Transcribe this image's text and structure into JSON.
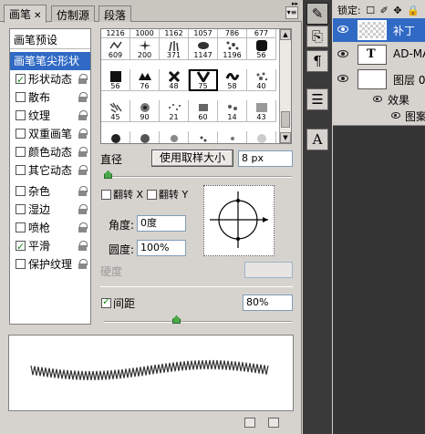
{
  "brush_panel": {
    "tabs": [
      "画笔",
      "仿制源",
      "段落"
    ],
    "list": {
      "header": "画笔预设",
      "selected": "画笔笔尖形状",
      "options": [
        {
          "label": "形状动态",
          "checked": true
        },
        {
          "label": "散布",
          "checked": false
        },
        {
          "label": "纹理",
          "checked": false
        },
        {
          "label": "双重画笔",
          "checked": false
        },
        {
          "label": "颜色动态",
          "checked": false
        },
        {
          "label": "其它动态",
          "checked": false
        },
        {
          "label": "杂色",
          "checked": false
        },
        {
          "label": "湿边",
          "checked": false
        },
        {
          "label": "喷枪",
          "checked": false
        },
        {
          "label": "平滑",
          "checked": true
        },
        {
          "label": "保护纹理",
          "checked": false
        }
      ]
    },
    "presets_top_numbers": [
      "1216",
      "1000",
      "1162",
      "1057",
      "786",
      "677"
    ],
    "preset_rows": [
      [
        "609",
        "200",
        "371",
        "1147",
        "1196",
        "56"
      ],
      [
        "56",
        "76",
        "48",
        "75",
        "58",
        "40"
      ],
      [
        "45",
        "90",
        "21",
        "60",
        "14",
        "43"
      ],
      [
        "",
        "",
        "",
        "",
        "",
        ""
      ]
    ],
    "selected_preset": "75",
    "diameter_label": "直径",
    "use_sample_size_button": "使用取样大小",
    "diameter_value": "8 px",
    "flip_x_label": "翻转 X",
    "flip_y_label": "翻转 Y",
    "angle_label": "角度:",
    "angle_value": "0度",
    "roundness_label": "圆度:",
    "roundness_value": "100%",
    "hardness_label": "硬度",
    "spacing_label": "间距",
    "spacing_checked": true,
    "spacing_value": "80%"
  },
  "layers_panel": {
    "lock_label": "锁定:",
    "layers": [
      {
        "name": "补丁",
        "type": "pixel",
        "selected": true
      },
      {
        "name": "AD-MAG",
        "type": "text",
        "selected": false
      },
      {
        "name": "图层 0",
        "type": "pixel",
        "selected": false
      }
    ],
    "effects_label": "效果",
    "effect_item": "图案"
  },
  "dock": {
    "icons": [
      "brush-tool-icon",
      "clone-source-icon",
      "paragraph-icon",
      "character-panel-icon",
      "type-icon"
    ]
  }
}
